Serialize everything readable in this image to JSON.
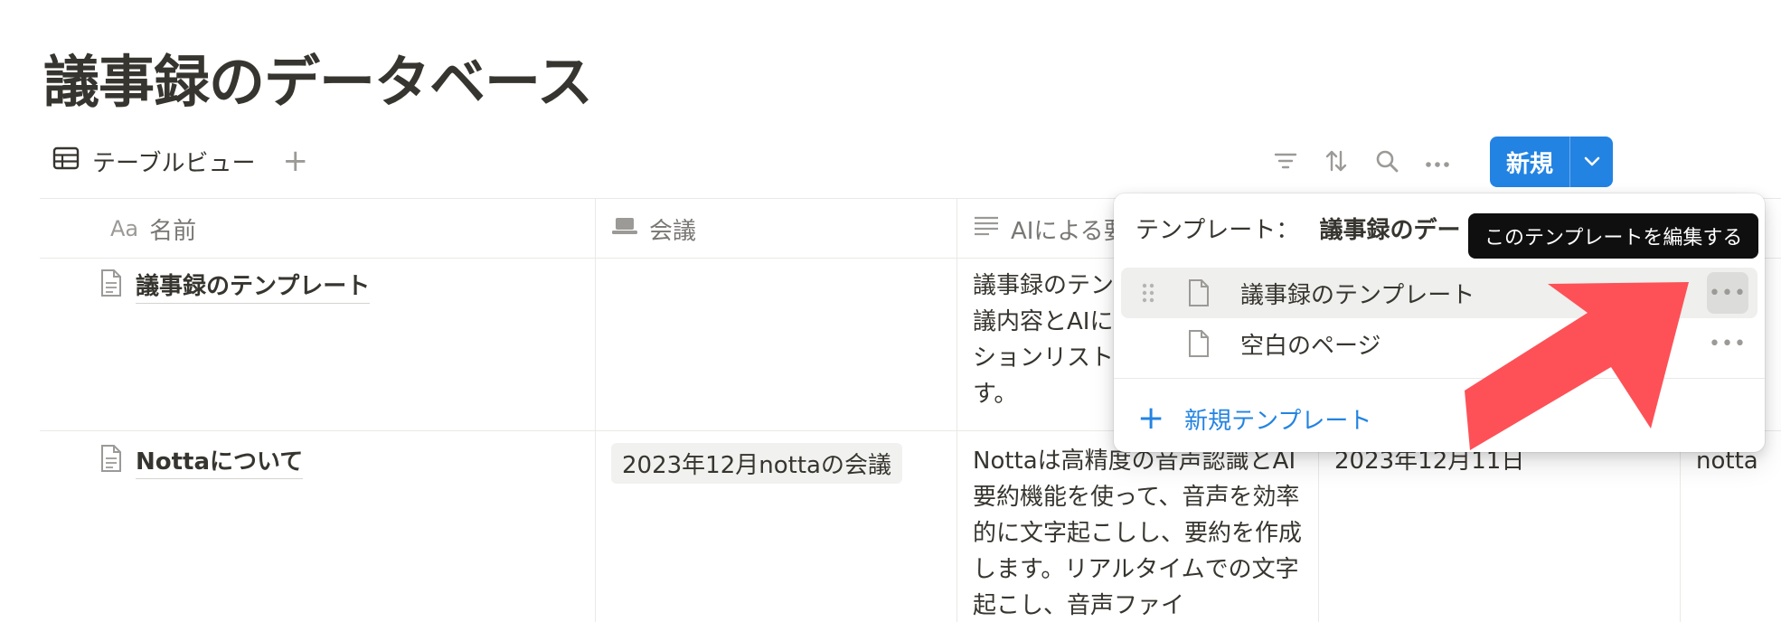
{
  "page_title": "議事録のデータベース",
  "view": {
    "tab_label": "テーブルビュー",
    "add_view": "+"
  },
  "toolbar": {
    "new_label": "新規"
  },
  "table": {
    "columns": [
      {
        "prefix": "Aa",
        "label": "名前"
      },
      {
        "label": "会議"
      },
      {
        "label": "AIによる要約"
      },
      {
        "label": ""
      },
      {
        "label": ""
      }
    ],
    "rows": [
      {
        "name": "議事録のテンプレート",
        "meeting": "",
        "summary": "議事録のテン 議内容とAIに ションリスト す。"
      },
      {
        "name": "Nottaについて",
        "meeting": "2023年12月nottaの会議",
        "summary": "Nottaは高精度の音声認識とAI要約機能を使って、音声を効率的に文字起こしし、要約を作成します。リアルタイムでの文字起こし、音声ファイ",
        "date": "2023年12月11日",
        "extra": "nottaに"
      }
    ]
  },
  "template_menu": {
    "header_label": "テンプレート：",
    "header_value": "議事録のデー",
    "items": [
      {
        "label": "議事録のテンプレート",
        "more": "•••"
      },
      {
        "label": "空白のページ",
        "more": "•••"
      }
    ],
    "new_template_label": "新規テンプレート",
    "new_template_plus": "+"
  },
  "tooltip": "このテンプレートを編集する",
  "colors": {
    "accent": "#2383e2",
    "arrow": "#fd5157",
    "text": "#37352f"
  }
}
